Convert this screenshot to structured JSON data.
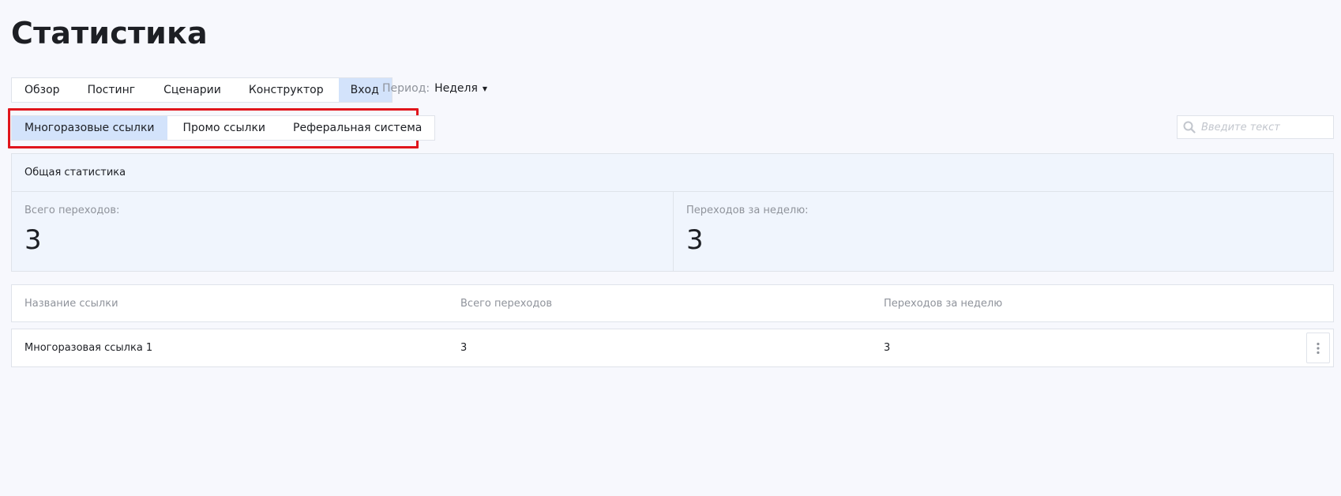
{
  "page": {
    "title": "Статистика"
  },
  "main_tabs": [
    {
      "label": "Обзор",
      "active": false
    },
    {
      "label": "Постинг",
      "active": false
    },
    {
      "label": "Сценарии",
      "active": false
    },
    {
      "label": "Конструктор",
      "active": false
    },
    {
      "label": "Вход",
      "active": true
    }
  ],
  "period": {
    "label": "Период:",
    "value": "Неделя"
  },
  "sub_tabs": [
    {
      "label": "Многоразовые ссылки",
      "active": true
    },
    {
      "label": "Промо ссылки",
      "active": false
    },
    {
      "label": "Реферальная система",
      "active": false
    }
  ],
  "search": {
    "placeholder": "Введите текст",
    "value": ""
  },
  "stats": {
    "title": "Общая статистика",
    "total_label": "Всего переходов:",
    "total_value": "3",
    "week_label": "Переходов за неделю:",
    "week_value": "3"
  },
  "table": {
    "headers": [
      "Название ссылки",
      "Всего переходов",
      "Переходов за неделю"
    ],
    "rows": [
      {
        "name": "Многоразовая ссылка 1",
        "total": "3",
        "week": "3"
      }
    ]
  },
  "colors": {
    "accent": "#d3e3fb",
    "highlight_border": "#e0151c",
    "stats_bg": "#f0f5fd",
    "page_bg": "#f7f8fd"
  },
  "icons": {
    "search": "search-icon",
    "more": "more-vertical-icon",
    "caret": "caret-down-icon"
  }
}
